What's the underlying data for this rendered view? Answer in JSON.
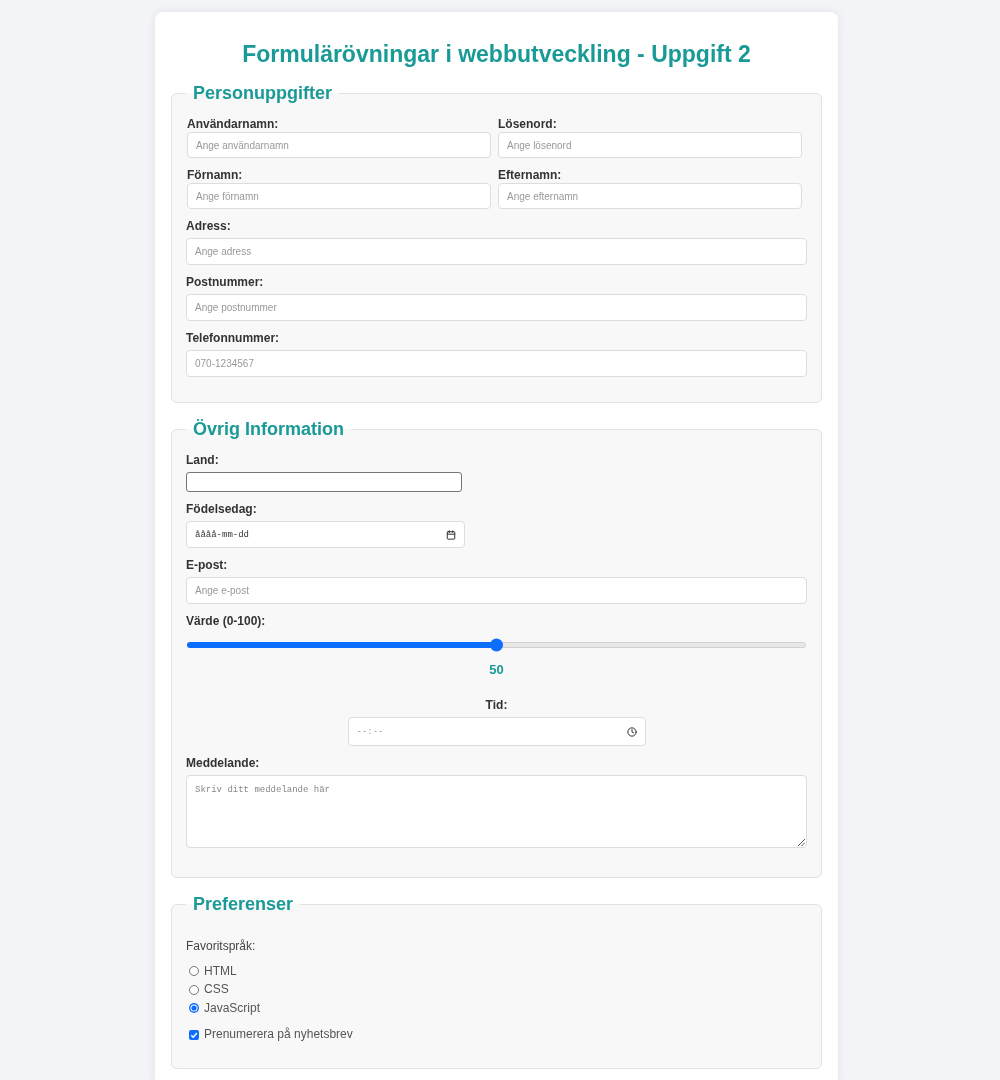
{
  "title": "Formulärövningar i webbutveckling - Uppgift 2",
  "sections": [
    {
      "legend": "Personuppgifter",
      "rows": [
        [
          {
            "kind": "text",
            "label": "Användarnamn:",
            "placeholder": "Ange användarnamn"
          },
          {
            "kind": "text",
            "label": "Lösenord:",
            "placeholder": "Ange lösenord"
          }
        ],
        [
          {
            "kind": "text",
            "label": "Förnamn:",
            "placeholder": "Ange förnamn"
          },
          {
            "kind": "text",
            "label": "Efternamn:",
            "placeholder": "Ange efternamn"
          }
        ],
        [
          {
            "kind": "text",
            "label": "Adress:",
            "placeholder": "Ange adress"
          }
        ],
        [
          {
            "kind": "text",
            "label": "Postnummer:",
            "placeholder": "Ange postnummer"
          }
        ],
        [
          {
            "kind": "text",
            "label": "Telefonnummer:",
            "placeholder": "070-1234567"
          }
        ]
      ]
    },
    {
      "legend": "Övrig Information",
      "rows": [
        [
          {
            "kind": "plain",
            "label": "Land:"
          }
        ],
        [
          {
            "kind": "date",
            "label": "Födelsedag:",
            "placeholder": "åååå-mm-dd"
          }
        ],
        [
          {
            "kind": "text",
            "label": "E-post:",
            "placeholder": "Ange e-post"
          }
        ],
        [
          {
            "kind": "range",
            "label": "Värde (0-100):",
            "level": 0.5,
            "reading": "50"
          }
        ],
        [
          {
            "kind": "time",
            "label": "Tid:",
            "placeholder": "--:--"
          }
        ],
        [
          {
            "kind": "textarea",
            "label": "Meddelande:",
            "placeholder": "Skriv ditt meddelande här"
          }
        ]
      ]
    },
    {
      "legend": "Preferenser",
      "rows": [
        [
          {
            "kind": "radios",
            "label": "Favoritspråk:",
            "options": [
              {
                "label": "HTML",
                "selected": false
              },
              {
                "label": "CSS",
                "selected": false
              },
              {
                "label": "JavaScript",
                "selected": true
              }
            ]
          }
        ],
        [
          {
            "kind": "checkbox",
            "label": "Prenumerera på nyhetsbrev",
            "checked": true
          }
        ]
      ]
    }
  ]
}
